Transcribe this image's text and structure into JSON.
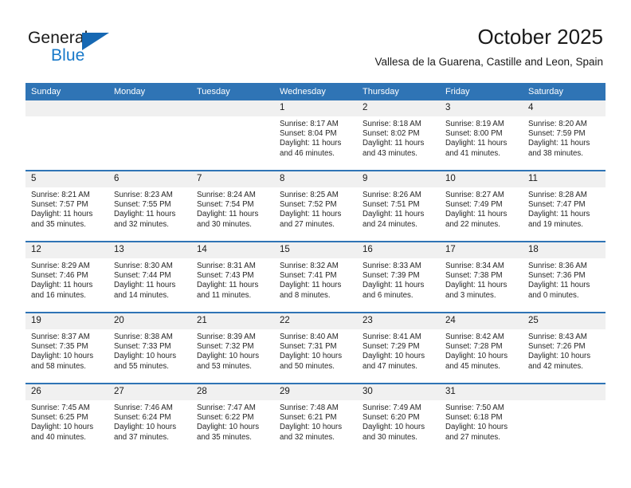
{
  "brand": {
    "name_part1": "General",
    "name_part2": "Blue",
    "flag_icon": "flag-triangle-icon",
    "accent_color": "#1879c9"
  },
  "header": {
    "month_title": "October 2025",
    "location": "Vallesa de la Guarena, Castille and Leon, Spain"
  },
  "calendar": {
    "header_bg": "#2f74b5",
    "daynum_bg": "#f0f0f0",
    "weekdays": [
      "Sunday",
      "Monday",
      "Tuesday",
      "Wednesday",
      "Thursday",
      "Friday",
      "Saturday"
    ],
    "weeks": [
      [
        {
          "day": "",
          "sunrise": "",
          "sunset": "",
          "daylight1": "",
          "daylight2": "",
          "empty": true
        },
        {
          "day": "",
          "sunrise": "",
          "sunset": "",
          "daylight1": "",
          "daylight2": "",
          "empty": true
        },
        {
          "day": "",
          "sunrise": "",
          "sunset": "",
          "daylight1": "",
          "daylight2": "",
          "empty": true
        },
        {
          "day": "1",
          "sunrise": "Sunrise: 8:17 AM",
          "sunset": "Sunset: 8:04 PM",
          "daylight1": "Daylight: 11 hours",
          "daylight2": "and 46 minutes."
        },
        {
          "day": "2",
          "sunrise": "Sunrise: 8:18 AM",
          "sunset": "Sunset: 8:02 PM",
          "daylight1": "Daylight: 11 hours",
          "daylight2": "and 43 minutes."
        },
        {
          "day": "3",
          "sunrise": "Sunrise: 8:19 AM",
          "sunset": "Sunset: 8:00 PM",
          "daylight1": "Daylight: 11 hours",
          "daylight2": "and 41 minutes."
        },
        {
          "day": "4",
          "sunrise": "Sunrise: 8:20 AM",
          "sunset": "Sunset: 7:59 PM",
          "daylight1": "Daylight: 11 hours",
          "daylight2": "and 38 minutes."
        }
      ],
      [
        {
          "day": "5",
          "sunrise": "Sunrise: 8:21 AM",
          "sunset": "Sunset: 7:57 PM",
          "daylight1": "Daylight: 11 hours",
          "daylight2": "and 35 minutes."
        },
        {
          "day": "6",
          "sunrise": "Sunrise: 8:23 AM",
          "sunset": "Sunset: 7:55 PM",
          "daylight1": "Daylight: 11 hours",
          "daylight2": "and 32 minutes."
        },
        {
          "day": "7",
          "sunrise": "Sunrise: 8:24 AM",
          "sunset": "Sunset: 7:54 PM",
          "daylight1": "Daylight: 11 hours",
          "daylight2": "and 30 minutes."
        },
        {
          "day": "8",
          "sunrise": "Sunrise: 8:25 AM",
          "sunset": "Sunset: 7:52 PM",
          "daylight1": "Daylight: 11 hours",
          "daylight2": "and 27 minutes."
        },
        {
          "day": "9",
          "sunrise": "Sunrise: 8:26 AM",
          "sunset": "Sunset: 7:51 PM",
          "daylight1": "Daylight: 11 hours",
          "daylight2": "and 24 minutes."
        },
        {
          "day": "10",
          "sunrise": "Sunrise: 8:27 AM",
          "sunset": "Sunset: 7:49 PM",
          "daylight1": "Daylight: 11 hours",
          "daylight2": "and 22 minutes."
        },
        {
          "day": "11",
          "sunrise": "Sunrise: 8:28 AM",
          "sunset": "Sunset: 7:47 PM",
          "daylight1": "Daylight: 11 hours",
          "daylight2": "and 19 minutes."
        }
      ],
      [
        {
          "day": "12",
          "sunrise": "Sunrise: 8:29 AM",
          "sunset": "Sunset: 7:46 PM",
          "daylight1": "Daylight: 11 hours",
          "daylight2": "and 16 minutes."
        },
        {
          "day": "13",
          "sunrise": "Sunrise: 8:30 AM",
          "sunset": "Sunset: 7:44 PM",
          "daylight1": "Daylight: 11 hours",
          "daylight2": "and 14 minutes."
        },
        {
          "day": "14",
          "sunrise": "Sunrise: 8:31 AM",
          "sunset": "Sunset: 7:43 PM",
          "daylight1": "Daylight: 11 hours",
          "daylight2": "and 11 minutes."
        },
        {
          "day": "15",
          "sunrise": "Sunrise: 8:32 AM",
          "sunset": "Sunset: 7:41 PM",
          "daylight1": "Daylight: 11 hours",
          "daylight2": "and 8 minutes."
        },
        {
          "day": "16",
          "sunrise": "Sunrise: 8:33 AM",
          "sunset": "Sunset: 7:39 PM",
          "daylight1": "Daylight: 11 hours",
          "daylight2": "and 6 minutes."
        },
        {
          "day": "17",
          "sunrise": "Sunrise: 8:34 AM",
          "sunset": "Sunset: 7:38 PM",
          "daylight1": "Daylight: 11 hours",
          "daylight2": "and 3 minutes."
        },
        {
          "day": "18",
          "sunrise": "Sunrise: 8:36 AM",
          "sunset": "Sunset: 7:36 PM",
          "daylight1": "Daylight: 11 hours",
          "daylight2": "and 0 minutes."
        }
      ],
      [
        {
          "day": "19",
          "sunrise": "Sunrise: 8:37 AM",
          "sunset": "Sunset: 7:35 PM",
          "daylight1": "Daylight: 10 hours",
          "daylight2": "and 58 minutes."
        },
        {
          "day": "20",
          "sunrise": "Sunrise: 8:38 AM",
          "sunset": "Sunset: 7:33 PM",
          "daylight1": "Daylight: 10 hours",
          "daylight2": "and 55 minutes."
        },
        {
          "day": "21",
          "sunrise": "Sunrise: 8:39 AM",
          "sunset": "Sunset: 7:32 PM",
          "daylight1": "Daylight: 10 hours",
          "daylight2": "and 53 minutes."
        },
        {
          "day": "22",
          "sunrise": "Sunrise: 8:40 AM",
          "sunset": "Sunset: 7:31 PM",
          "daylight1": "Daylight: 10 hours",
          "daylight2": "and 50 minutes."
        },
        {
          "day": "23",
          "sunrise": "Sunrise: 8:41 AM",
          "sunset": "Sunset: 7:29 PM",
          "daylight1": "Daylight: 10 hours",
          "daylight2": "and 47 minutes."
        },
        {
          "day": "24",
          "sunrise": "Sunrise: 8:42 AM",
          "sunset": "Sunset: 7:28 PM",
          "daylight1": "Daylight: 10 hours",
          "daylight2": "and 45 minutes."
        },
        {
          "day": "25",
          "sunrise": "Sunrise: 8:43 AM",
          "sunset": "Sunset: 7:26 PM",
          "daylight1": "Daylight: 10 hours",
          "daylight2": "and 42 minutes."
        }
      ],
      [
        {
          "day": "26",
          "sunrise": "Sunrise: 7:45 AM",
          "sunset": "Sunset: 6:25 PM",
          "daylight1": "Daylight: 10 hours",
          "daylight2": "and 40 minutes."
        },
        {
          "day": "27",
          "sunrise": "Sunrise: 7:46 AM",
          "sunset": "Sunset: 6:24 PM",
          "daylight1": "Daylight: 10 hours",
          "daylight2": "and 37 minutes."
        },
        {
          "day": "28",
          "sunrise": "Sunrise: 7:47 AM",
          "sunset": "Sunset: 6:22 PM",
          "daylight1": "Daylight: 10 hours",
          "daylight2": "and 35 minutes."
        },
        {
          "day": "29",
          "sunrise": "Sunrise: 7:48 AM",
          "sunset": "Sunset: 6:21 PM",
          "daylight1": "Daylight: 10 hours",
          "daylight2": "and 32 minutes."
        },
        {
          "day": "30",
          "sunrise": "Sunrise: 7:49 AM",
          "sunset": "Sunset: 6:20 PM",
          "daylight1": "Daylight: 10 hours",
          "daylight2": "and 30 minutes."
        },
        {
          "day": "31",
          "sunrise": "Sunrise: 7:50 AM",
          "sunset": "Sunset: 6:18 PM",
          "daylight1": "Daylight: 10 hours",
          "daylight2": "and 27 minutes."
        },
        {
          "day": "",
          "sunrise": "",
          "sunset": "",
          "daylight1": "",
          "daylight2": "",
          "empty": true
        }
      ]
    ]
  }
}
